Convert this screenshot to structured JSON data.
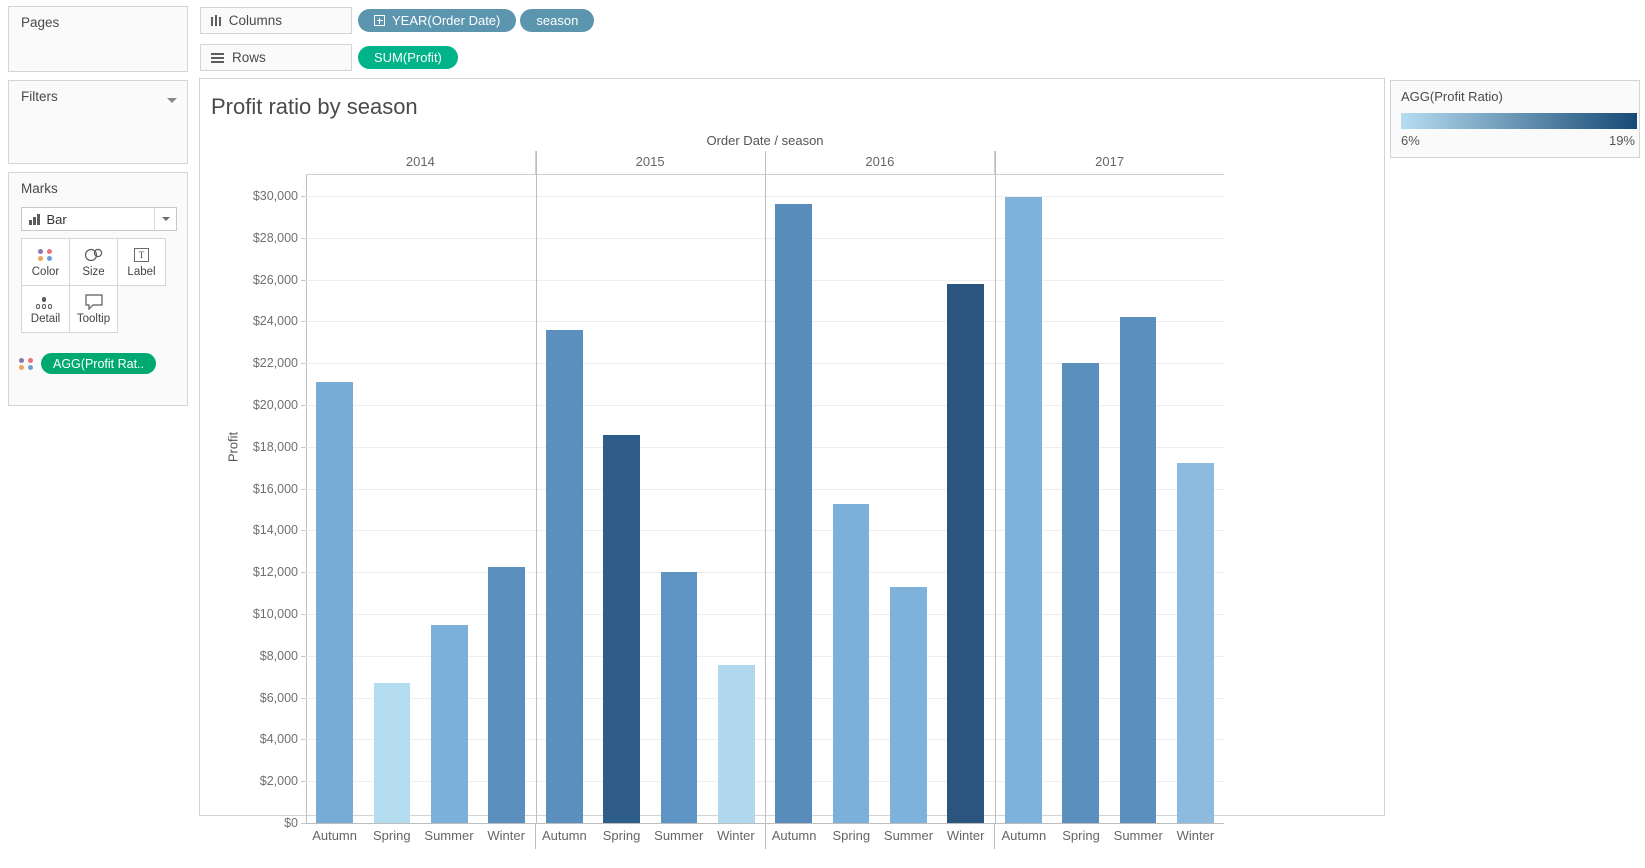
{
  "left_panel": {
    "pages": {
      "title": "Pages"
    },
    "filters": {
      "title": "Filters"
    },
    "marks": {
      "title": "Marks",
      "mark_type": "Bar",
      "buttons": [
        {
          "label": "Color",
          "icon": "color-dots-icon"
        },
        {
          "label": "Size",
          "icon": "size-circles-icon"
        },
        {
          "label": "Label",
          "icon": "label-t-icon"
        },
        {
          "label": "Detail",
          "icon": "detail-dots-icon"
        },
        {
          "label": "Tooltip",
          "icon": "tooltip-bubble-icon"
        }
      ],
      "pill": "AGG(Profit Rat.."
    }
  },
  "shelves": {
    "columns_label": "Columns",
    "rows_label": "Rows",
    "columns_pills": [
      {
        "text": "YEAR(Order Date)",
        "has_plus": true,
        "color": "#5b96ae"
      },
      {
        "text": "season",
        "has_plus": false,
        "color": "#5b96ae"
      }
    ],
    "rows_pills": [
      {
        "text": "SUM(Profit)",
        "has_plus": false,
        "color": "#00b388"
      }
    ]
  },
  "legend": {
    "title": "AGG(Profit Ratio)",
    "min": "6%",
    "max": "19%",
    "ramp_from": "#b6dcf0",
    "ramp_to": "#174a75"
  },
  "viz": {
    "title": "Profit ratio by season"
  },
  "chart_data": {
    "type": "bar",
    "title": "Profit ratio by season",
    "xlabel": "Order Date / season",
    "ylabel": "Profit",
    "ylim": [
      0,
      31000
    ],
    "grid": true,
    "legend_position": "right",
    "ytick_labels": [
      "$30,000",
      "$28,000",
      "$26,000",
      "$24,000",
      "$22,000",
      "$20,000",
      "$18,000",
      "$16,000",
      "$14,000",
      "$12,000",
      "$10,000",
      "$8,000",
      "$6,000",
      "$4,000",
      "$2,000",
      "$0"
    ],
    "ytick_values": [
      30000,
      28000,
      26000,
      24000,
      22000,
      20000,
      18000,
      16000,
      14000,
      12000,
      10000,
      8000,
      6000,
      4000,
      2000,
      0
    ],
    "groups": [
      "2014",
      "2015",
      "2016",
      "2017"
    ],
    "categories": [
      "Autumn",
      "Spring",
      "Summer",
      "Winter"
    ],
    "color_field": "AGG(Profit Ratio)",
    "bars": [
      {
        "group": "2014",
        "category": "Autumn",
        "value": 21100,
        "color": "#78abd6"
      },
      {
        "group": "2014",
        "category": "Spring",
        "value": 6700,
        "color": "#b6dcf0"
      },
      {
        "group": "2014",
        "category": "Summer",
        "value": 9450,
        "color": "#7db0d8"
      },
      {
        "group": "2014",
        "category": "Winter",
        "value": 12250,
        "color": "#5b8fbe"
      },
      {
        "group": "2015",
        "category": "Autumn",
        "value": 23600,
        "color": "#5b8fbe"
      },
      {
        "group": "2015",
        "category": "Spring",
        "value": 18550,
        "color": "#2e5d8a"
      },
      {
        "group": "2015",
        "category": "Summer",
        "value": 12000,
        "color": "#5e94c3"
      },
      {
        "group": "2015",
        "category": "Winter",
        "value": 7550,
        "color": "#b0d7ee"
      },
      {
        "group": "2016",
        "category": "Autumn",
        "value": 29600,
        "color": "#578cbb"
      },
      {
        "group": "2016",
        "category": "Spring",
        "value": 15250,
        "color": "#7cb0d8"
      },
      {
        "group": "2016",
        "category": "Summer",
        "value": 11300,
        "color": "#7fb2da"
      },
      {
        "group": "2016",
        "category": "Winter",
        "value": 25800,
        "color": "#2b557e"
      },
      {
        "group": "2017",
        "category": "Autumn",
        "value": 29950,
        "color": "#7fb2da"
      },
      {
        "group": "2017",
        "category": "Spring",
        "value": 22000,
        "color": "#5b8fbe"
      },
      {
        "group": "2017",
        "category": "Summer",
        "value": 24200,
        "color": "#5b8fbe"
      },
      {
        "group": "2017",
        "category": "Winter",
        "value": 17200,
        "color": "#8dbbdf"
      }
    ]
  }
}
